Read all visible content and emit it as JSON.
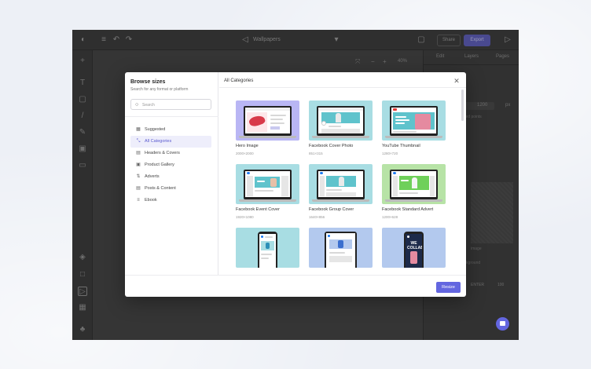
{
  "app": {
    "document_title": "Wallpapers",
    "share_label": "Share",
    "export_label": "Export",
    "right_tabs": [
      "Edit",
      "Layers",
      "Pages"
    ],
    "zoom_level": "40%",
    "panel_labels": [
      "1200",
      "px",
      "linked points",
      "image",
      "background",
      "ENTER",
      "100"
    ]
  },
  "modal": {
    "title": "Browse sizes",
    "subtitle": "Search for any format or platform",
    "search_placeholder": "Search",
    "section_title": "All Categories",
    "categories": [
      {
        "label": "Suggested",
        "icon": "grid-icon"
      },
      {
        "label": "All Categories",
        "icon": "expand-icon",
        "active": true
      },
      {
        "label": "Headers & Covers",
        "icon": "header-icon"
      },
      {
        "label": "Product Gallery",
        "icon": "gallery-icon"
      },
      {
        "label": "Adverts",
        "icon": "advert-icon"
      },
      {
        "label": "Posts & Content",
        "icon": "post-icon"
      },
      {
        "label": "Ebook",
        "icon": "ebook-icon"
      }
    ],
    "cards": [
      {
        "title": "Hero Image",
        "size": "2000×2000"
      },
      {
        "title": "Facebook Cover Photo",
        "size": "851×315"
      },
      {
        "title": "YouTube Thumbnail",
        "size": "1280×720"
      },
      {
        "title": "Facebook Event Cover",
        "size": "1920×1080"
      },
      {
        "title": "Facebook Group Cover",
        "size": "1640×856"
      },
      {
        "title": "Facebook Standard Advert",
        "size": "1200×628"
      },
      {
        "title": "",
        "size": ""
      },
      {
        "title": "",
        "size": ""
      },
      {
        "title": "",
        "size": ""
      }
    ],
    "resize_label": "Resize",
    "phone_promo_text": "WE COLLAB"
  },
  "colors": {
    "accent": "#6366e0",
    "thumb_purple": "#b9b6f4",
    "thumb_teal": "#a8dde3",
    "thumb_green": "#b7e3a6",
    "thumb_blue": "#b3c9ee"
  }
}
